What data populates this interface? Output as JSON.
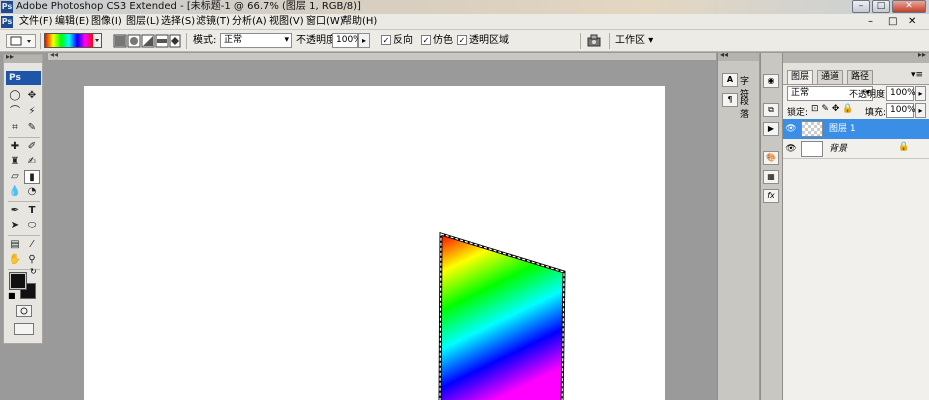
{
  "window": {
    "app_icon": "Ps",
    "title": "Adobe Photoshop CS3 Extended - [未标题-1 @ 66.7% (图层 1, RGB/8)]",
    "controls": [
      "–",
      "□",
      "✕"
    ]
  },
  "menubar": {
    "doc_icon": "Ps",
    "items": [
      "文件(F)",
      "编辑(E)",
      "图像(I)",
      "图层(L)",
      "选择(S)",
      "滤镜(T)",
      "分析(A)",
      "视图(V)",
      "窗口(W)",
      "帮助(H)"
    ],
    "doc_controls": [
      "–",
      "□",
      "✕"
    ]
  },
  "options": {
    "mode_label": "模式:",
    "mode_value": "正常",
    "opacity_label": "不透明度:",
    "opacity_value": "100%",
    "reverse_label": "反向",
    "dither_label": "仿色",
    "transparency_label": "透明区域",
    "workspace_label": "工作区",
    "gradient_colors": [
      "#ff0000",
      "#ffff00",
      "#00ff00",
      "#00ffff",
      "#0000ff",
      "#ff00ff",
      "#ff0000"
    ]
  },
  "toolbox": {
    "logo": "Ps",
    "foreground_color": "#111111",
    "background_color": "#111111"
  },
  "dock": {
    "char_label": "字符",
    "para_label": "段落"
  },
  "layers_panel": {
    "tabs": [
      "图层",
      "通道",
      "路径"
    ],
    "blend_mode": "正常",
    "opacity_label": "不透明度:",
    "opacity_value": "100%",
    "lock_label": "锁定:",
    "fill_label": "填充:",
    "fill_value": "100%",
    "layers": [
      {
        "name": "图层 1",
        "selected": true
      },
      {
        "name": "背景",
        "selected": false,
        "locked": true
      }
    ]
  },
  "document": {
    "shape_colors": [
      "#ff0000",
      "#ffff00",
      "#00ff00",
      "#00ffff",
      "#0000ff",
      "#ff00ff"
    ]
  }
}
